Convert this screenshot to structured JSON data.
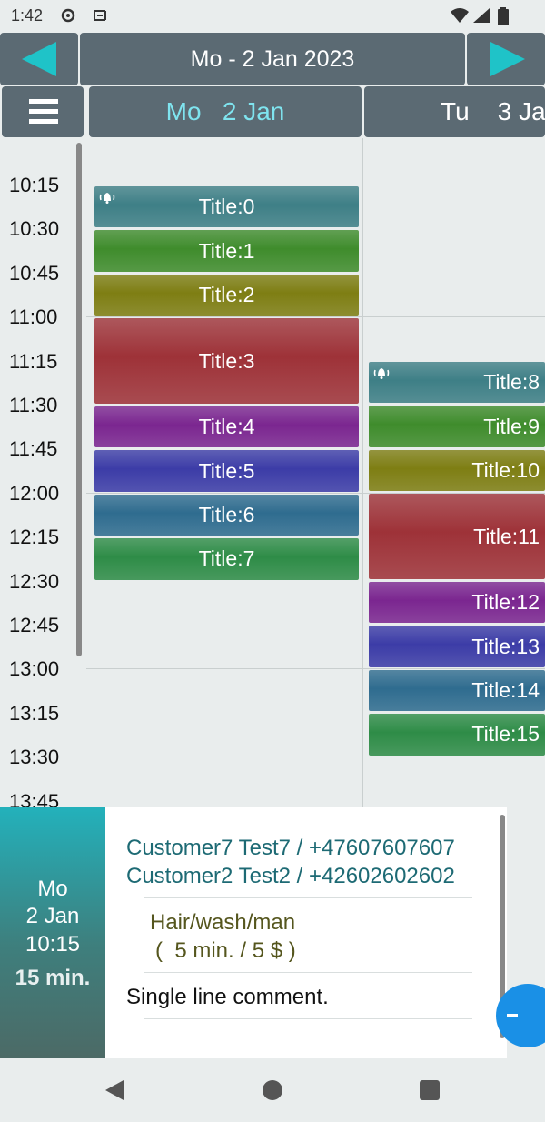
{
  "status_bar": {
    "time": "1:42"
  },
  "header": {
    "title": "Mo - 2 Jan 2023"
  },
  "day_headers": [
    {
      "name": "Mo",
      "date": "2 Jan",
      "color": "#7fe4ef"
    },
    {
      "name": "Tu",
      "date": "3 Ja",
      "color": "#ffffff"
    }
  ],
  "time_labels": [
    "10:15",
    "10:30",
    "10:45",
    "11:00",
    "11:15",
    "11:30",
    "11:45",
    "12:00",
    "12:15",
    "12:30",
    "12:45",
    "13:00",
    "13:15",
    "13:30",
    "13:45"
  ],
  "events_day1": [
    {
      "title": "Title:0",
      "color": "#3e7f86",
      "alarm": true
    },
    {
      "title": "Title:1",
      "color": "#3f8c2c"
    },
    {
      "title": "Title:2",
      "color": "#7e7e13"
    },
    {
      "title": "Title:3",
      "color": "#9e3238"
    },
    {
      "title": "Title:4",
      "color": "#7b2690"
    },
    {
      "title": "Title:5",
      "color": "#3c3ca7"
    },
    {
      "title": "Title:6",
      "color": "#2f6c8f"
    },
    {
      "title": "Title:7",
      "color": "#2e8c47"
    }
  ],
  "events_day2": [
    {
      "title": "Title:8",
      "color": "#3e7f86",
      "alarm": true
    },
    {
      "title": "Title:9",
      "color": "#3f8c2c"
    },
    {
      "title": "Title:10",
      "color": "#7e7e13"
    },
    {
      "title": "Title:11",
      "color": "#9e3238"
    },
    {
      "title": "Title:12",
      "color": "#7b2690"
    },
    {
      "title": "Title:13",
      "color": "#3c3ca7"
    },
    {
      "title": "Title:14",
      "color": "#2f6c8f"
    },
    {
      "title": "Title:15",
      "color": "#2e8c47"
    }
  ],
  "detail_card": {
    "day": "Mo",
    "date": "2 Jan",
    "time": "10:15",
    "duration": "15 min.",
    "customers": [
      "Customer7 Test7 / +47607607607",
      "Customer2 Test2 / +42602602602"
    ],
    "service_name": "Hair/wash/man",
    "service_details": "(  5 min. / 5 $ )",
    "comment": "Single line comment."
  },
  "colors": {
    "accent": "#1fc3c8",
    "header_bg": "#5b6a73",
    "fab": "#1a90e6"
  }
}
